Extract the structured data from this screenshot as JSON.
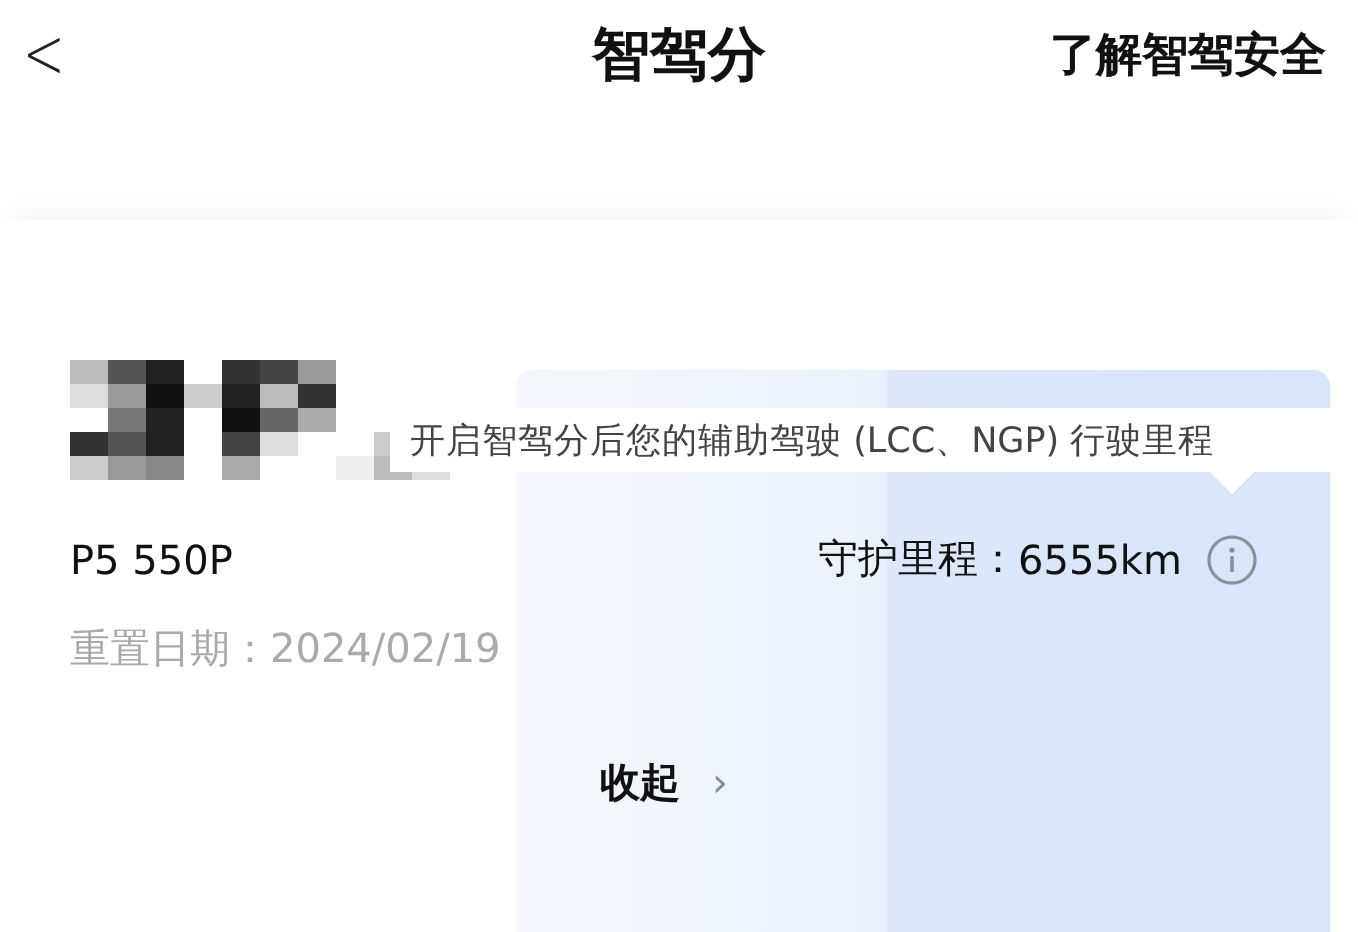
{
  "header": {
    "back": "<",
    "title": "智驾分",
    "link": "了解智驾安全"
  },
  "card": {
    "tooltip": "开启智驾分后您的辅助驾驶 (LCC、NGP) 行驶里程",
    "model": "P5 550P",
    "mileage_label": "守护里程：",
    "mileage_value": "6555km",
    "reset_date": "重置日期：2024/02/19",
    "collapse": "收起",
    "collapse_arrow": "›"
  }
}
